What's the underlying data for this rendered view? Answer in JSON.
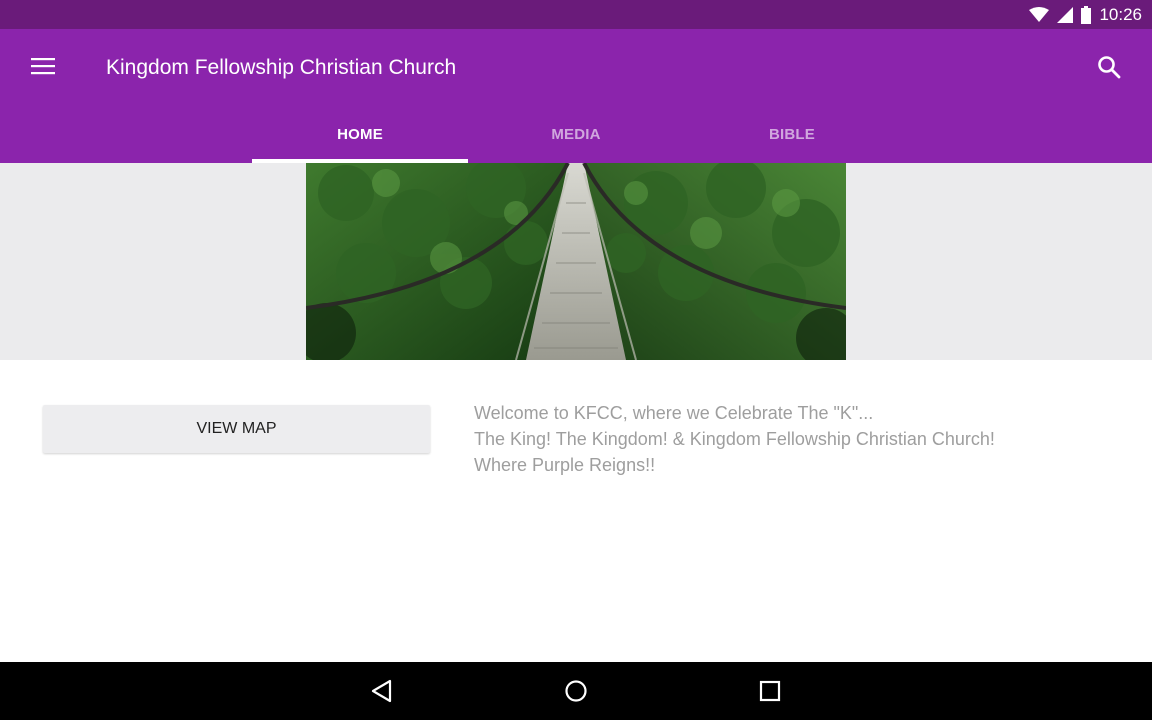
{
  "status_bar": {
    "time": "10:26",
    "icons": [
      "wifi-icon",
      "cell-signal-icon",
      "battery-icon"
    ]
  },
  "app_bar": {
    "title": "Kingdom Fellowship Christian Church",
    "menu_icon": "menu-icon",
    "search_icon": "search-icon",
    "color": "#8b24ac",
    "status_color": "#6a1b7a"
  },
  "tabs": [
    {
      "label": "HOME",
      "active": true
    },
    {
      "label": "MEDIA",
      "active": false
    },
    {
      "label": "BIBLE",
      "active": false
    }
  ],
  "banner": {
    "image": "suspension-bridge-forest-photo"
  },
  "main": {
    "view_map_label": "VIEW MAP",
    "welcome_lines": [
      "Welcome to KFCC, where we Celebrate The \"K\"...",
      "The King! The Kingdom! &  Kingdom Fellowship Christian Church!",
      "Where Purple Reigns!!"
    ]
  },
  "nav_bar": {
    "buttons": [
      "back-icon",
      "home-icon",
      "recents-icon"
    ]
  }
}
